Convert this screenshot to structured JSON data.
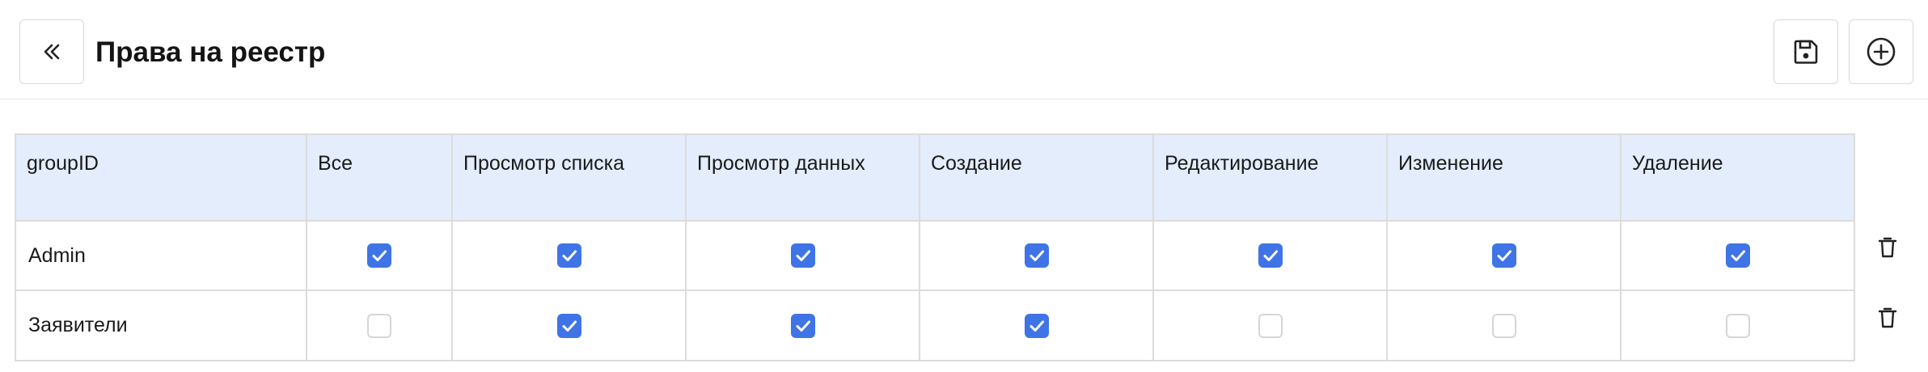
{
  "header": {
    "title": "Права на реестр",
    "back_icon": "double-chevron-left-icon",
    "save_icon": "save-icon",
    "add_icon": "plus-circle-icon"
  },
  "table": {
    "columns": [
      "groupID",
      "Все",
      "Просмотр списка",
      "Просмотр данных",
      "Создание",
      "Редактирование",
      "Изменение",
      "Удаление"
    ],
    "rows": [
      {
        "group": "Admin",
        "permissions": [
          true,
          true,
          true,
          true,
          true,
          true,
          true
        ]
      },
      {
        "group": "Заявители",
        "permissions": [
          false,
          true,
          true,
          true,
          false,
          false,
          false
        ]
      }
    ]
  },
  "row_action_icon": "trash-icon",
  "colors": {
    "accent": "#3f74e6",
    "header_bg": "#e3edfb",
    "border": "#dcdcdc"
  }
}
